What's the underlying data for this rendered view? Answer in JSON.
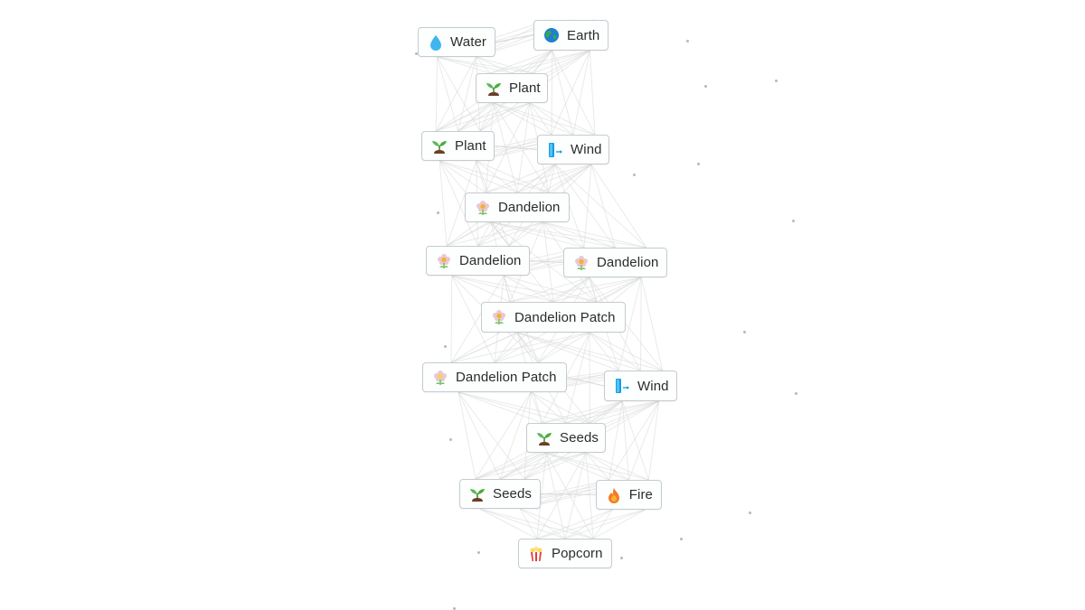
{
  "app": {
    "view": "crafting-canvas"
  },
  "nodes": [
    {
      "id": "water",
      "label": "Water",
      "icon": "water-drop-icon"
    },
    {
      "id": "earth",
      "label": "Earth",
      "icon": "globe-icon"
    },
    {
      "id": "plant-1",
      "label": "Plant",
      "icon": "seedling-icon"
    },
    {
      "id": "plant-2",
      "label": "Plant",
      "icon": "seedling-icon"
    },
    {
      "id": "wind-1",
      "label": "Wind",
      "icon": "wind-icon"
    },
    {
      "id": "dandelion-1",
      "label": "Dandelion",
      "icon": "flower-icon"
    },
    {
      "id": "dandelion-2",
      "label": "Dandelion",
      "icon": "flower-icon"
    },
    {
      "id": "dandelion-3",
      "label": "Dandelion",
      "icon": "flower-icon"
    },
    {
      "id": "patch-1",
      "label": "Dandelion Patch",
      "icon": "flower-icon"
    },
    {
      "id": "patch-2",
      "label": "Dandelion Patch",
      "icon": "flower-icon"
    },
    {
      "id": "wind-2",
      "label": "Wind",
      "icon": "wind-icon"
    },
    {
      "id": "seeds-1",
      "label": "Seeds",
      "icon": "seedling-icon"
    },
    {
      "id": "seeds-2",
      "label": "Seeds",
      "icon": "seedling-icon"
    },
    {
      "id": "fire",
      "label": "Fire",
      "icon": "fire-icon"
    },
    {
      "id": "popcorn",
      "label": "Popcorn",
      "icon": "popcorn-icon"
    }
  ],
  "colors": {
    "edge": "#d9d9d9",
    "node_border": "#c4cbd2",
    "node_bg": "#fdfefe",
    "text": "#2b2b2b",
    "dot": "#b9b9b9"
  }
}
